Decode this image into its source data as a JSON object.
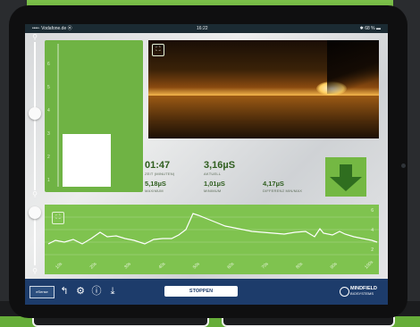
{
  "status_bar": {
    "carrier": "••••◦ Vodafone.de ⦿",
    "time": "16:22",
    "battery": "✱ 68 % ▬"
  },
  "bar_scale": [
    "1",
    "2",
    "3",
    "4",
    "5",
    "6"
  ],
  "bar_level": 0.36,
  "slider_top_level": 0.52,
  "slider_bottom_level": 0.1,
  "icons": {
    "expand": "expand-icon",
    "zoom": "magnifier-icon",
    "back": "back-arrow-icon",
    "settings": "gear-icon",
    "info": "info-icon",
    "download": "download-icon"
  },
  "metrics": {
    "time_value": "01:47",
    "time_label": "ZEIT (MINUTEN)",
    "current_value": "3,16µS",
    "current_label": "AKTUELL",
    "max_value": "5,18µS",
    "max_label": "MAXIMUM",
    "min_value": "1,01µS",
    "min_label": "MINIMUM",
    "diff_value": "4,17µS",
    "diff_label": "DIFFERENZ MIN/MAX"
  },
  "graph": {
    "x_ticks": [
      "10s",
      "20s",
      "30s",
      "40s",
      "50s",
      "60s",
      "70s",
      "80s",
      "90s",
      "100s"
    ],
    "y_ticks": [
      "6",
      "4",
      "2"
    ]
  },
  "toolbar": {
    "logo_text": "eSense",
    "stop_label": "STOPPEN",
    "brand_line1": "MINDFIELD",
    "brand_line2": "BIOSYSTEMS"
  },
  "colors": {
    "accent_green": "#6fb344",
    "dark_green": "#2f6e1f",
    "toolbar_blue": "#1d3c6b"
  }
}
